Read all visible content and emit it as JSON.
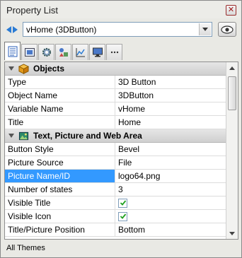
{
  "window": {
    "title": "Property List",
    "close_glyph": "✕"
  },
  "selector": {
    "value": "vHome (3DButton)"
  },
  "tabs": [
    {
      "icon": "property-list-icon",
      "active": true
    },
    {
      "icon": "picture-frame-icon"
    },
    {
      "icon": "gear-icon"
    },
    {
      "icon": "shapes-icon"
    },
    {
      "icon": "line-chart-icon"
    },
    {
      "icon": "monitor-icon"
    },
    {
      "icon": "more-icon"
    }
  ],
  "sections": [
    {
      "title": "Objects",
      "icon": "cube-icon",
      "rows": [
        {
          "name": "Type",
          "value": "3D Button"
        },
        {
          "name": "Object Name",
          "value": "3DButton"
        },
        {
          "name": "Variable Name",
          "value": "vHome"
        },
        {
          "name": "Title",
          "value": "Home"
        }
      ]
    },
    {
      "title": "Text, Picture and Web Area",
      "icon": "picture-icon",
      "rows": [
        {
          "name": "Button Style",
          "value": "Bevel"
        },
        {
          "name": "Picture Source",
          "value": "File"
        },
        {
          "name": "Picture Name/ID",
          "value": "logo64.png",
          "selected": true
        },
        {
          "name": "Number of states",
          "value": "3"
        },
        {
          "name": "Visible Title",
          "checkbox": true,
          "checked": true
        },
        {
          "name": "Visible Icon",
          "checkbox": true,
          "checked": true
        },
        {
          "name": "Title/Picture Position",
          "value": "Bottom"
        }
      ]
    }
  ],
  "footer": {
    "text": "All Themes"
  },
  "colors": {
    "selection": "#3399ff",
    "nav_arrow": "#2a7bd4",
    "close": "#a01919"
  }
}
